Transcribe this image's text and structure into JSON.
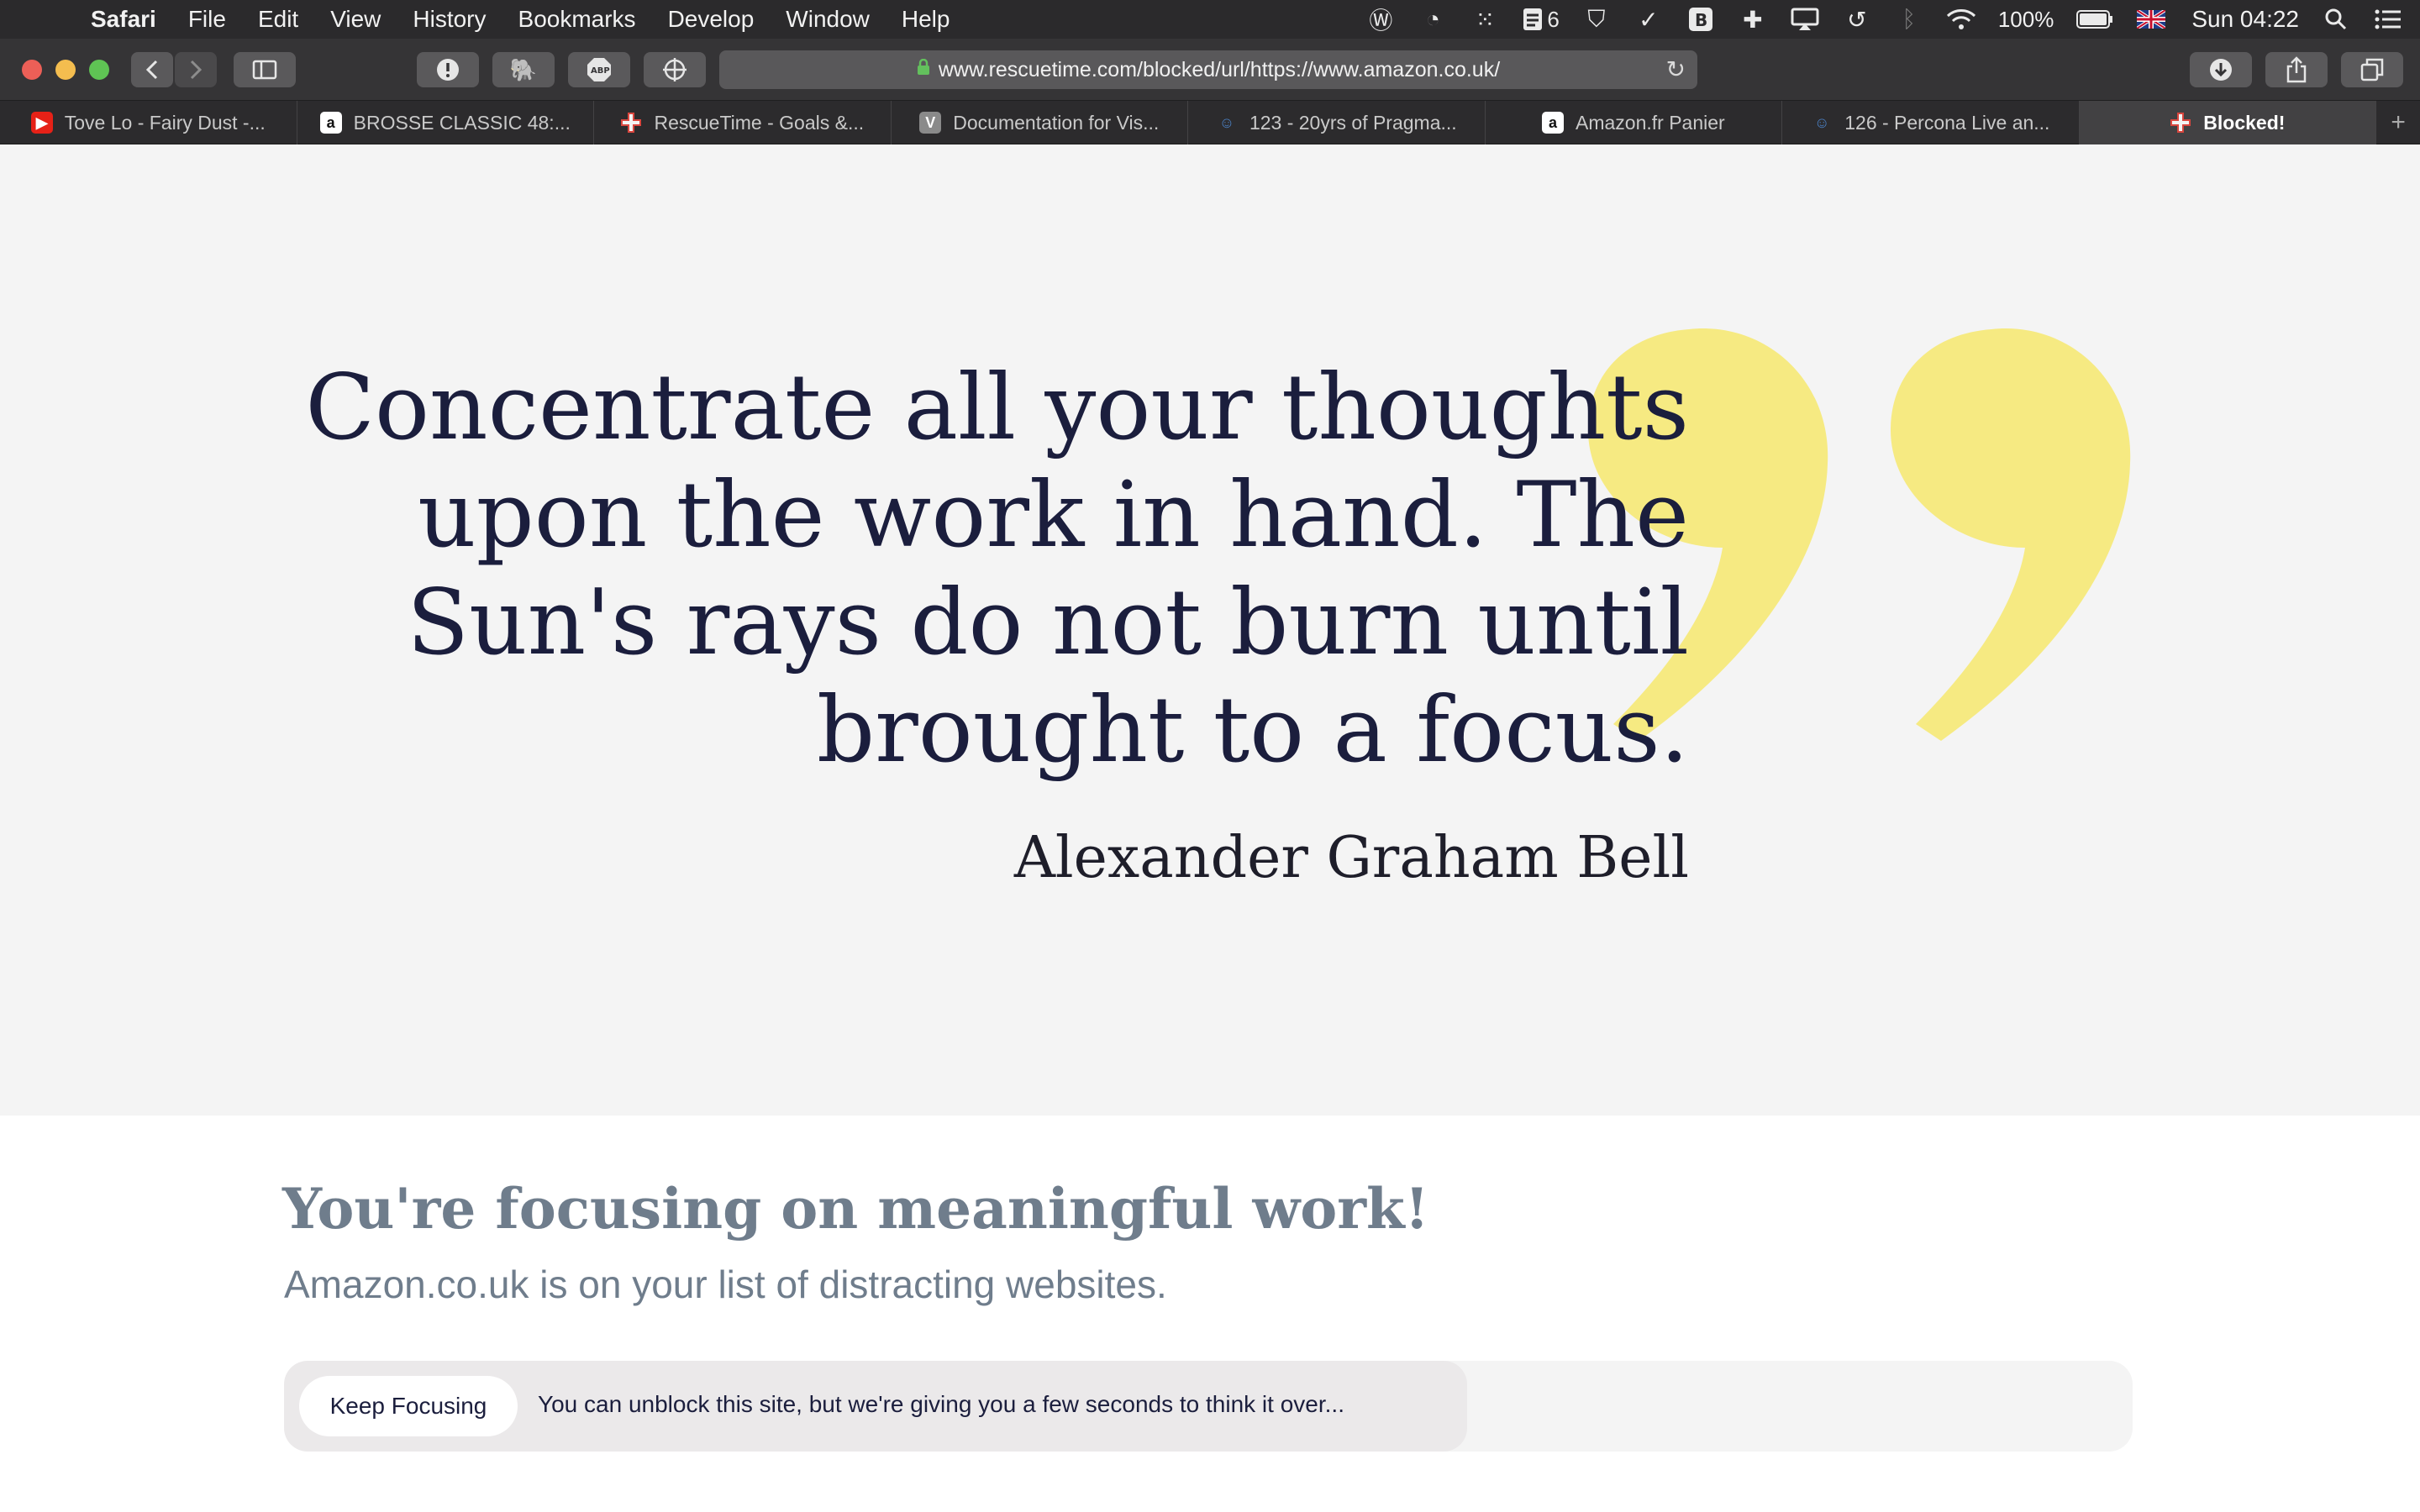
{
  "menubar": {
    "apple_icon": "apple-logo-icon",
    "items": [
      "Safari",
      "File",
      "Edit",
      "View",
      "History",
      "Bookmarks",
      "Develop",
      "Window",
      "Help"
    ],
    "status": {
      "notification_count": "6",
      "battery": "100%",
      "clock": "Sun 04:22"
    }
  },
  "toolbar": {
    "url": "www.rescuetime.com/blocked/url/https://www.amazon.co.uk/"
  },
  "tabs": [
    {
      "title": "Tove Lo - Fairy Dust -...",
      "favicon": "youtube-icon",
      "color": "#e62117"
    },
    {
      "title": "BROSSE CLASSIC 48:...",
      "favicon": "amazon-icon",
      "color": "#ffffff"
    },
    {
      "title": "RescueTime - Goals &...",
      "favicon": "rescuetime-icon",
      "color": "#d9463e"
    },
    {
      "title": "Documentation for Vis...",
      "favicon": "v-icon",
      "color": "#8a8a8a"
    },
    {
      "title": "123 - 20yrs of Pragma...",
      "favicon": "podcast-face-icon",
      "color": "#4a7fc1"
    },
    {
      "title": "Amazon.fr Panier",
      "favicon": "amazon-icon",
      "color": "#ffffff"
    },
    {
      "title": "126 - Percona Live an...",
      "favicon": "podcast-face-icon",
      "color": "#4a7fc1"
    },
    {
      "title": "Blocked!",
      "favicon": "rescuetime-icon",
      "color": "#d9463e",
      "active": true
    }
  ],
  "quote": {
    "text": "Concentrate all your thoughts upon the work in hand. The Sun's rays do not burn until brought to a focus.",
    "author": "Alexander Graham Bell",
    "mark_color": "#f6ea82"
  },
  "blocked": {
    "title": "You're focusing on meaningful work!",
    "subtitle": "Amazon.co.uk is on your list of distracting websites.",
    "keep_focusing_label": "Keep Focusing",
    "unblock_message": "You can unblock this site, but we're giving you a few seconds to think it over...",
    "unblock_progress": 0.64
  }
}
